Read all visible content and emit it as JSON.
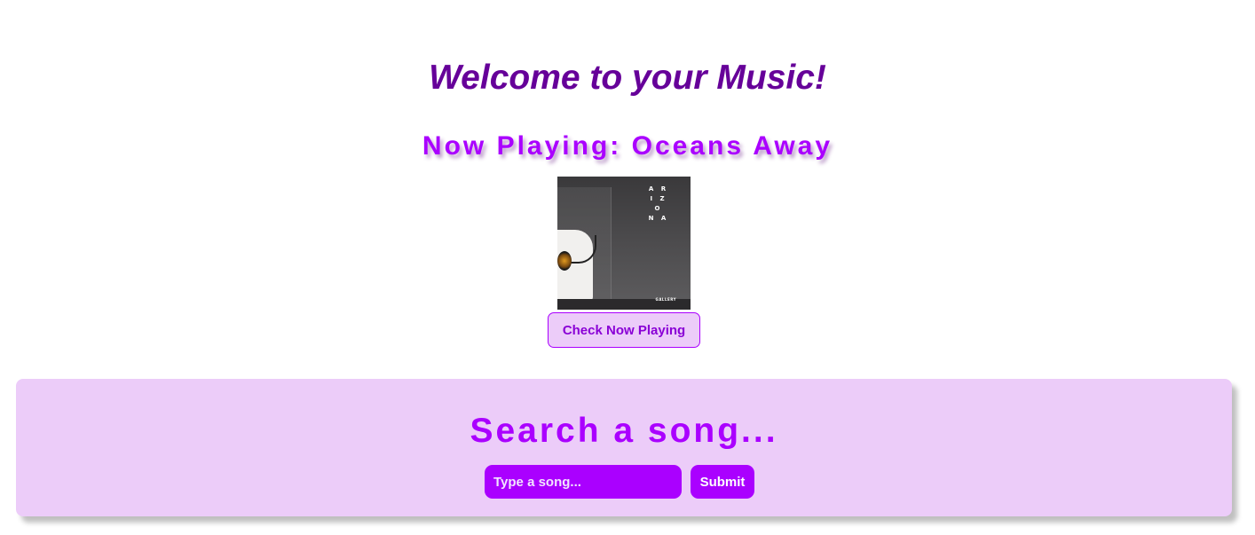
{
  "header": {
    "welcome": "Welcome to your Music!",
    "now_playing": "Now Playing: Oceans Away"
  },
  "album_cover": {
    "band_lines": [
      "A R",
      "I Z O",
      "N A"
    ],
    "footer_text": "GALLERY"
  },
  "now_playing_button": {
    "label": "Check Now Playing"
  },
  "search": {
    "title": "Search a song...",
    "placeholder": "Type a song...",
    "value": "",
    "submit_label": "Submit"
  },
  "colors": {
    "welcome_text": "#660099",
    "accent": "#aa00ff",
    "panel_bg": "#ecccf9",
    "background": "#ffffff"
  }
}
